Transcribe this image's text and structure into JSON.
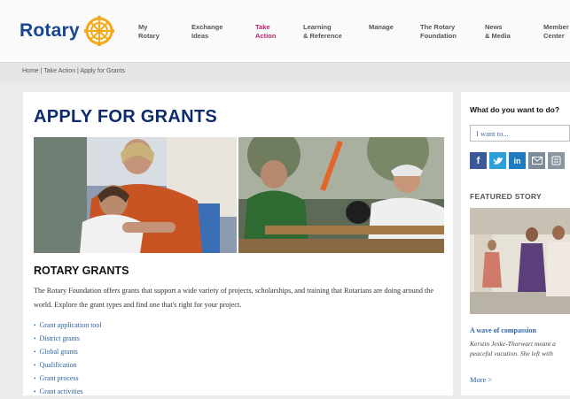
{
  "logo": {
    "text": "Rotary"
  },
  "nav": [
    {
      "line1": "My",
      "line2": "Rotary"
    },
    {
      "line1": "Exchange",
      "line2": "Ideas"
    },
    {
      "line1": "Take",
      "line2": "Action"
    },
    {
      "line1": "Learning",
      "line2": "& Reference"
    },
    {
      "line1": "Manage",
      "line2": ""
    },
    {
      "line1": "The Rotary",
      "line2": "Foundation"
    },
    {
      "line1": "News",
      "line2": "& Media"
    },
    {
      "line1": "Member",
      "line2": "Center"
    }
  ],
  "breadcrumb": {
    "home": "Home",
    "sep": " | ",
    "section": "Take Action",
    "current": "Apply for Grants"
  },
  "page": {
    "title": "APPLY FOR GRANTS",
    "section_title": "ROTARY GRANTS",
    "description": "The Rotary Foundation offers grants that support a wide variety of projects, scholarships, and training that Rotarians are doing around the world. Explore the grant types and find one that's right for your project."
  },
  "links": [
    "Grant application tool",
    "District grants",
    "Global grants",
    "Qualification",
    "Grant process",
    "Grant activities"
  ],
  "sidebar": {
    "heading": "What do you want to do?",
    "select_value": "I want to...",
    "featured_label": "FEATURED STORY",
    "story_title": "A wave of compassion",
    "story_text": "Kerstin Jeske-Thorwart meant a peaceful vacation. She left with",
    "more": "More >"
  },
  "colors": {
    "brand_blue": "#17458f",
    "accent_magenta": "#b8236e",
    "link_blue": "#2d63a8",
    "gold": "#f7a81b"
  }
}
